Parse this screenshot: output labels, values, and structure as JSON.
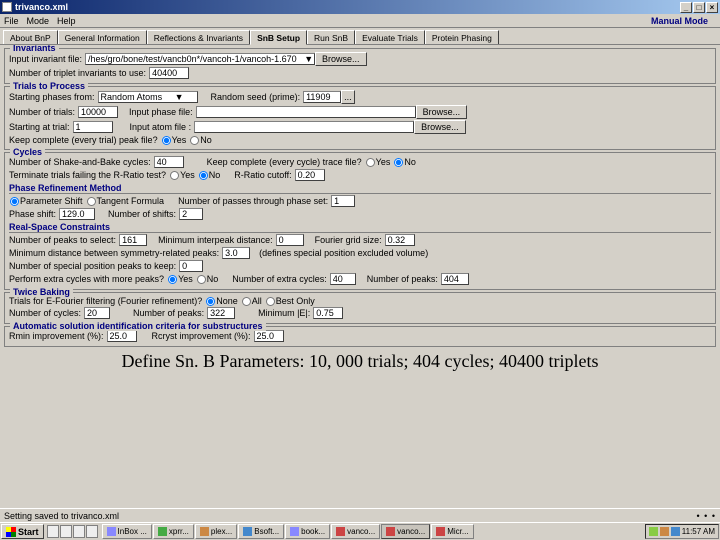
{
  "window": {
    "title": "trivanco.xml",
    "min": "_",
    "max": "□",
    "close": "×"
  },
  "menu": {
    "file": "File",
    "mode": "Mode",
    "help": "Help",
    "right": "Manual Mode"
  },
  "tabs": {
    "t0": "About BnP",
    "t1": "General Information",
    "t2": "Reflections & Invariants",
    "t3": "SnB Setup",
    "t4": "Run SnB",
    "t5": "Evaluate Trials",
    "t6": "Protein Phasing"
  },
  "inv": {
    "title": "Invariants",
    "file_lbl": "Input invariant file:",
    "file_val": "/hes/gro/bone/test/vancb0n*/vancoh-1/vancoh-1.670   ▼",
    "browse": "Browse...",
    "ntrip_lbl": "Number of triplet invariants to use:",
    "ntrip_val": "40400"
  },
  "trials": {
    "title": "Trials to Process",
    "start_from_lbl": "Starting phases from:",
    "start_from_val": "Random Atoms     ▼",
    "seed_lbl": "Random seed (prime):",
    "seed_val": "11909",
    "seed_btn": "...",
    "ntrials_lbl": "Number of trials:",
    "ntrials_val": "10000",
    "ip_file_lbl": "Input phase file:",
    "ip_file_val": "",
    "browse": "Browse...",
    "start_at_lbl": "Starting at trial:",
    "start_at_val": "1",
    "ia_file_lbl": "Input atom file :",
    "ia_file_val": "",
    "keep_lbl": "Keep complete (every trial) peak file?",
    "yes": "Yes",
    "no": "No"
  },
  "cycles": {
    "title": "Cycles",
    "nsb_lbl": "Number of Shake-and-Bake cycles:",
    "nsb_val": "40",
    "keep_trace_lbl": "Keep complete (every cycle) trace file?",
    "term_lbl": "Terminate trials failing the R-Ratio test?",
    "rr_lbl": "R-Ratio cutoff:",
    "rr_val": "0.20",
    "yes": "Yes",
    "no": "No"
  },
  "prm": {
    "title": "Phase Refinement Method",
    "ps": "Parameter Shift",
    "tf": "Tangent Formula",
    "npass_lbl": "Number of passes through phase set:",
    "npass_val": "1",
    "shift_lbl": "Phase shift:",
    "shift_val": "129.0",
    "nshift_lbl": "Number of shifts:",
    "nshift_val": "2"
  },
  "rsc": {
    "title": "Real-Space Constraints",
    "npk_lbl": "Number of peaks to select:",
    "npk_val": "161",
    "mind_lbl": "Minimum interpeak distance:",
    "mind_val": "0",
    "grid_lbl": "Fourier grid size:",
    "grid_val": "0.32",
    "msym_lbl": "Minimum distance between symmetry-related peaks:",
    "msym_val": "3.0",
    "def_note": "(defines special position excluded volume)",
    "nsp_lbl": "Number of special position peaks to keep:",
    "nsp_val": "0",
    "extra_lbl": "Perform extra cycles with more peaks?",
    "nextra_lbl": "Number of extra cycles:",
    "nextra_val": "40",
    "npkx_lbl": "Number of peaks:",
    "npkx_val": "404",
    "yes": "Yes",
    "no": "No"
  },
  "tr": {
    "title": "Twice Baking",
    "ef_lbl": "Trials for E-Fourier filtering (Fourier refinement)?",
    "none": "None",
    "all": "All",
    "best": "Best Only",
    "ncyc_lbl": "Number of cycles:",
    "ncyc_val": "20",
    "npk_lbl": "Number of peaks:",
    "npk_val": "322",
    "mine_lbl": "Minimum |E|:",
    "mine_val": "0.75"
  },
  "auto": {
    "title": "Automatic solution identification criteria for substructures",
    "rmin_lbl": "Rmin improvement (%):",
    "rmin_val": "25.0",
    "rcryst_lbl": "Rcryst improvement (%):",
    "rcryst_val": "25.0"
  },
  "caption": "Define Sn. B Parameters: 10, 000 trials; 404 cycles; 40400 triplets",
  "status": {
    "text": "Setting saved to trivanco.xml",
    "dots": "• • •"
  },
  "task": {
    "start": "Start",
    "b0": "InBox ...",
    "b1": "xprr...",
    "b2": "plex...",
    "b3": "Bsoft...",
    "b4": "book...",
    "b5": "vanco...",
    "b6": "vanco...",
    "b7": "Micr...",
    "time": "11:57 AM"
  }
}
